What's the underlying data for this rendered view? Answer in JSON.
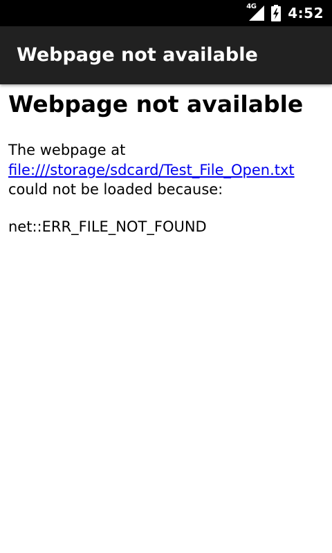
{
  "status_bar": {
    "network_type": "4G",
    "time": "4:52",
    "icons": [
      "signal-icon",
      "battery-charging-icon"
    ]
  },
  "app_bar": {
    "title": "Webpage not available",
    "background_color": "#212121"
  },
  "error": {
    "heading": "Webpage not available",
    "intro_text": "The webpage at",
    "url": "file:///storage/sdcard/Test_File_Open.txt",
    "reason_text": "could not be loaded because:",
    "error_code": "net::ERR_FILE_NOT_FOUND",
    "link_color": "#0000ee"
  }
}
